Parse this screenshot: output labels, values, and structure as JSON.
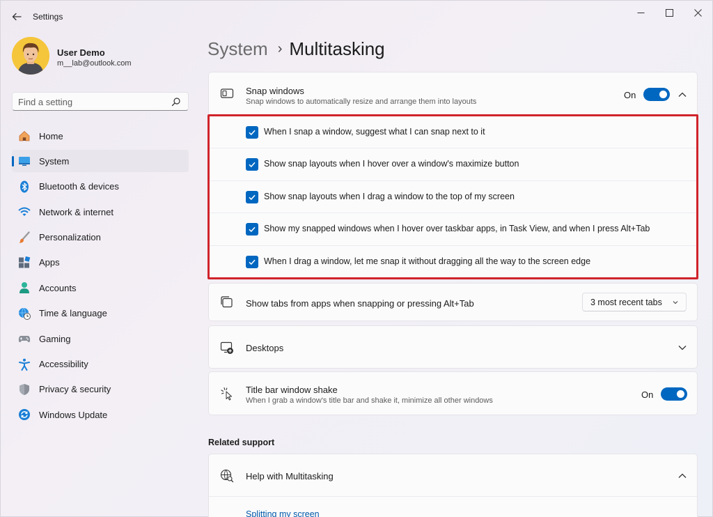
{
  "window": {
    "title": "Settings",
    "back_label": "←",
    "minimize_label": "—",
    "maximize_label": "☐",
    "close_label": "✕"
  },
  "profile": {
    "name": "User Demo",
    "email": "m__lab@outlook.com"
  },
  "search": {
    "placeholder": "Find a setting"
  },
  "sidebar": {
    "items": [
      {
        "label": "Home",
        "icon": "home-icon",
        "active": false
      },
      {
        "label": "System",
        "icon": "system-icon",
        "active": true
      },
      {
        "label": "Bluetooth & devices",
        "icon": "bluetooth-icon",
        "active": false
      },
      {
        "label": "Network & internet",
        "icon": "wifi-icon",
        "active": false
      },
      {
        "label": "Personalization",
        "icon": "brush-icon",
        "active": false
      },
      {
        "label": "Apps",
        "icon": "apps-icon",
        "active": false
      },
      {
        "label": "Accounts",
        "icon": "person-icon",
        "active": false
      },
      {
        "label": "Time & language",
        "icon": "globe-clock-icon",
        "active": false
      },
      {
        "label": "Gaming",
        "icon": "controller-icon",
        "active": false
      },
      {
        "label": "Accessibility",
        "icon": "accessibility-icon",
        "active": false
      },
      {
        "label": "Privacy & security",
        "icon": "shield-icon",
        "active": false
      },
      {
        "label": "Windows Update",
        "icon": "update-icon",
        "active": false
      }
    ]
  },
  "breadcrumb": {
    "parent": "System",
    "separator": "›",
    "current": "Multitasking"
  },
  "snap_windows": {
    "title": "Snap windows",
    "description": "Snap windows to automatically resize and arrange them into layouts",
    "state_label": "On",
    "enabled": true,
    "expanded": true,
    "options": [
      {
        "label": "When I snap a window, suggest what I can snap next to it",
        "checked": true
      },
      {
        "label": "Show snap layouts when I hover over a window's maximize button",
        "checked": true
      },
      {
        "label": "Show snap layouts when I drag a window to the top of my screen",
        "checked": true
      },
      {
        "label": "Show my snapped windows when I hover over taskbar apps, in Task View, and when I press Alt+Tab",
        "checked": true
      },
      {
        "label": "When I drag a window, let me snap it without dragging all the way to the screen edge",
        "checked": true
      }
    ]
  },
  "show_tabs": {
    "title": "Show tabs from apps when snapping or pressing Alt+Tab",
    "selected_option": "3 most recent tabs"
  },
  "desktops": {
    "title": "Desktops"
  },
  "title_bar_shake": {
    "title": "Title bar window shake",
    "description": "When I grab a window's title bar and shake it, minimize all other windows",
    "state_label": "On",
    "enabled": true
  },
  "related_support": {
    "header": "Related support",
    "help_title": "Help with Multitasking",
    "link": "Splitting my screen"
  },
  "colors": {
    "accent": "#0067c0",
    "highlight_border": "#d0232b"
  }
}
